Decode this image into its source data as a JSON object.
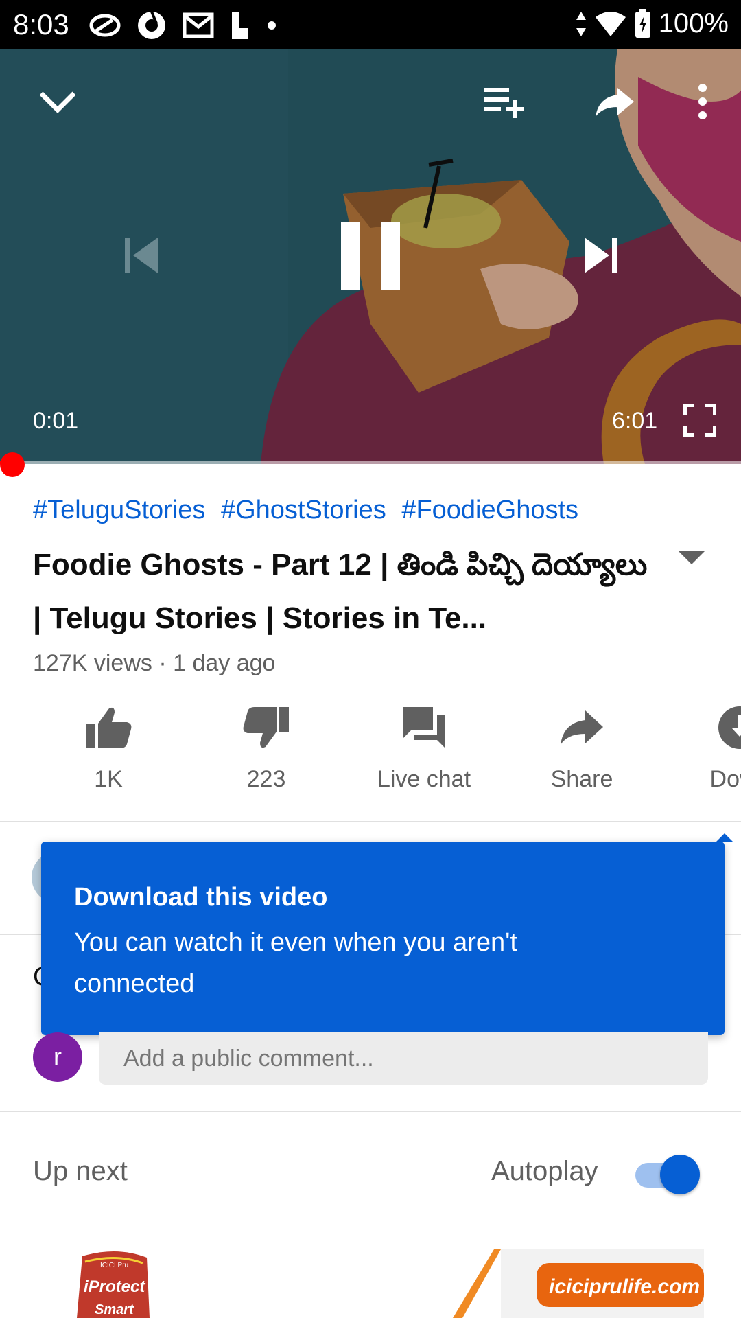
{
  "status_bar": {
    "time": "8:03",
    "battery": "100%"
  },
  "player": {
    "current_time": "0:01",
    "duration": "6:01",
    "progress_fraction": 0.003
  },
  "video": {
    "hashtags": [
      "#TeluguStories",
      "#GhostStories",
      "#FoodieGhosts"
    ],
    "title": "Foodie Ghosts - Part 12 | తిండి పిచ్చి దెయ్యాలు | Telugu Stories | Stories in Te...",
    "meta": "127K views · 1 day ago"
  },
  "actions": {
    "like": "1K",
    "dislike": "223",
    "live_chat": "Live chat",
    "share": "Share",
    "download": "Down"
  },
  "comments": {
    "label_partial": "C",
    "avatar_letter": "r",
    "placeholder": "Add a public comment..."
  },
  "tooltip": {
    "title": "Download this video",
    "body": "You can watch it even when you aren't connected"
  },
  "up_next": {
    "label": "Up next",
    "autoplay_label": "Autoplay",
    "autoplay_on": true
  },
  "ad": {
    "logo_line1": "ICICI Pru",
    "logo_line2": "iProtect",
    "logo_line3": "Smart",
    "site": "iciciprulife.com"
  },
  "colors": {
    "accent_blue": "#065fd4",
    "progress_red": "#ff0000",
    "avatar_purple": "#7b1fa2"
  }
}
